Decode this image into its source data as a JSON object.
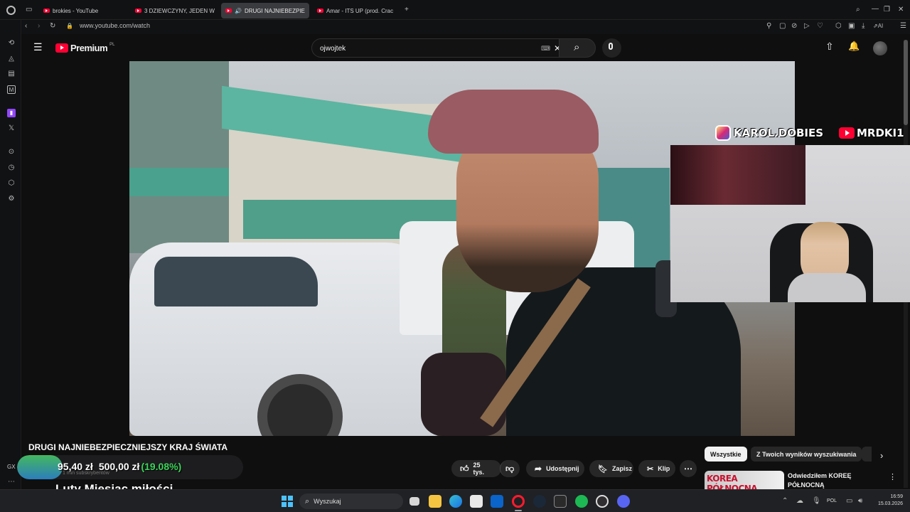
{
  "browser": {
    "tabs": [
      {
        "label": "brokies - YouTube",
        "active": false
      },
      {
        "label": "3 DZIEWCZYNY, JEDEN W",
        "active": false
      },
      {
        "label": "DRUGI NAJNIEBEZPIE",
        "active": true
      },
      {
        "label": "Amar - ITS UP (prod. Crac",
        "active": false
      }
    ],
    "url": "www.youtube.com/watch"
  },
  "youtube": {
    "logo_text": "Premium",
    "logo_region": "PL",
    "search_value": "ojwojtek"
  },
  "overlays": {
    "instagram_handle": "KAROL.DOBIES",
    "youtube_handle": "MRDKI1"
  },
  "video": {
    "title": "DRUGI NAJNIEBEZPIECZNIEJSZY KRAJ ŚWIATA",
    "subscribers_ghost": "1 mln subskrybentów"
  },
  "stream_overlay": {
    "goal_current": "95,40 zł",
    "goal_target": "500,00 zł",
    "goal_percent": "(19.08%)",
    "goal_fraction": 0.1908,
    "caption": "Luty Miesiąc miłości",
    "gx_label": "GX"
  },
  "actions": {
    "likes": "25 tys.",
    "share": "Udostępnij",
    "save": "Zapisz",
    "clip": "Klip"
  },
  "filters": {
    "all": "Wszystkie",
    "from_search": "Z Twoich wyników wyszukiwania"
  },
  "recommendation": {
    "thumb_text": "KOREA PÓŁNOCNA",
    "title_line1": "Odwiedziłem KOREĘ",
    "title_line2": "PÓŁNOCNĄ"
  },
  "taskbar": {
    "search_placeholder": "Wyszukaj",
    "lang": "POL",
    "time": "16:59",
    "date": "15.03.2026"
  },
  "colors": {
    "accent_red": "#ff0033",
    "goal_green": "#3cd45a"
  }
}
